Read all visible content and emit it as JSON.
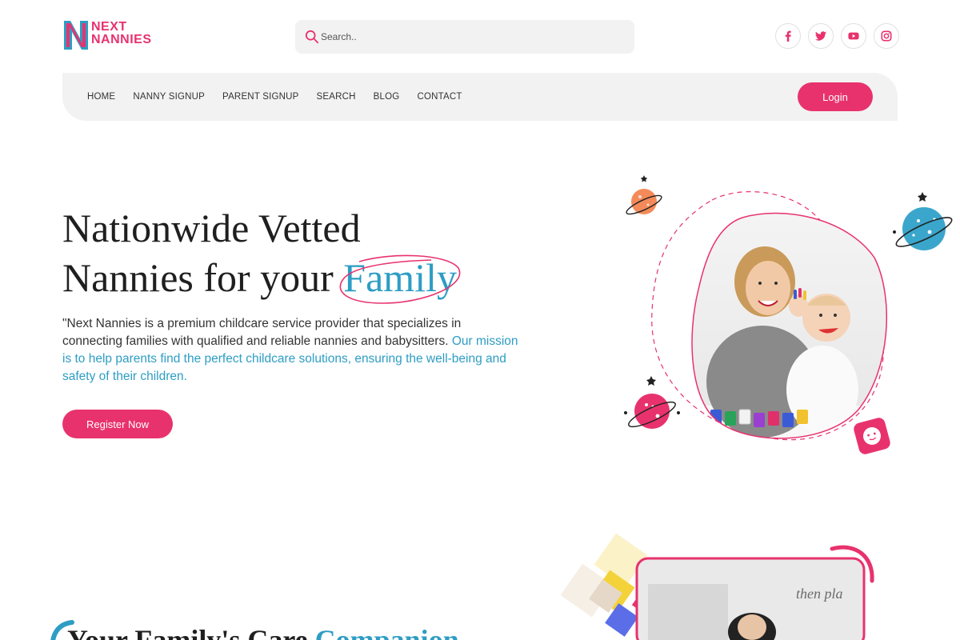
{
  "brand": {
    "line1": "NEXT",
    "line2": "NANNIES",
    "pink": "#e8326e",
    "blue": "#2e9dc4"
  },
  "search": {
    "placeholder": "Search.."
  },
  "socials": [
    "facebook-icon",
    "twitter-icon",
    "youtube-icon",
    "instagram-icon"
  ],
  "nav": {
    "items": [
      {
        "label": "HOME"
      },
      {
        "label": "NANNY SIGNUP"
      },
      {
        "label": "PARENT SIGNUP"
      },
      {
        "label": "SEARCH"
      },
      {
        "label": "BLOG"
      },
      {
        "label": "CONTACT"
      }
    ],
    "login_label": "Login"
  },
  "hero": {
    "title_line1": "Nationwide Vetted",
    "title_line2_prefix": "Nannies for your ",
    "title_accent": "Family",
    "desc_plain": "\"Next Nannies is a premium childcare service provider that specializes in connecting families with qualified and reliable nannies and babysitters. ",
    "desc_blue": "Our mission is to help parents find the perfect childcare solutions, ensuring the well-being and safety of their children.",
    "cta_label": "Register Now"
  },
  "section2": {
    "title_prefix": "Your Family's Care ",
    "title_accent": "Companion"
  }
}
